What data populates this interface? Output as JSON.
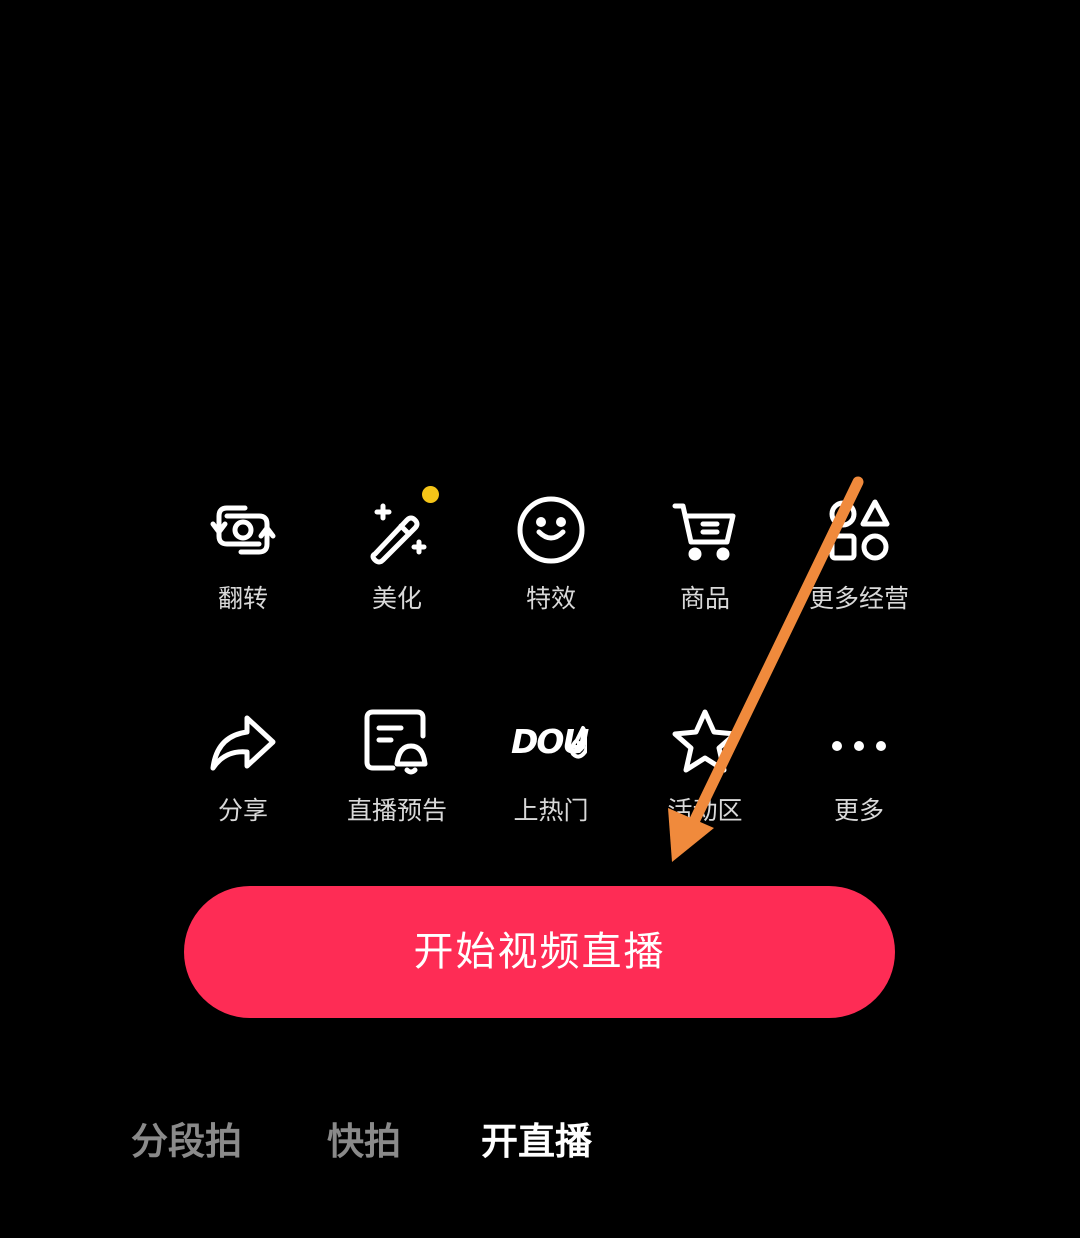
{
  "colors": {
    "background": "#000000",
    "primary": "#fe2c55",
    "label": "#d9d9d9",
    "mode_inactive": "#8a8a8a",
    "mode_active": "#ffffff",
    "badge_dot": "#f5c518",
    "annotation_arrow": "#f08a3c"
  },
  "tools_row1": [
    {
      "label": "翻转",
      "icon": "flip-camera-icon"
    },
    {
      "label": "美化",
      "icon": "magic-wand-icon",
      "badge": "yellow-dot"
    },
    {
      "label": "特效",
      "icon": "smiley-face-icon"
    },
    {
      "label": "商品",
      "icon": "shopping-cart-icon"
    },
    {
      "label": "更多经营",
      "icon": "shapes-grid-icon"
    }
  ],
  "tools_row2": [
    {
      "label": "分享",
      "icon": "share-arrow-icon"
    },
    {
      "label": "直播预告",
      "icon": "live-notice-bell-icon"
    },
    {
      "label": "上热门",
      "icon": "dou-plus-icon",
      "icon_text": "DOU"
    },
    {
      "label": "活动区",
      "icon": "star-icon"
    },
    {
      "label": "更多",
      "icon": "more-dots-icon"
    }
  ],
  "start_button": {
    "label": "开始视频直播"
  },
  "modes": [
    {
      "label": "分段拍",
      "active": false
    },
    {
      "label": "快拍",
      "active": false
    },
    {
      "label": "开直播",
      "active": true
    }
  ]
}
